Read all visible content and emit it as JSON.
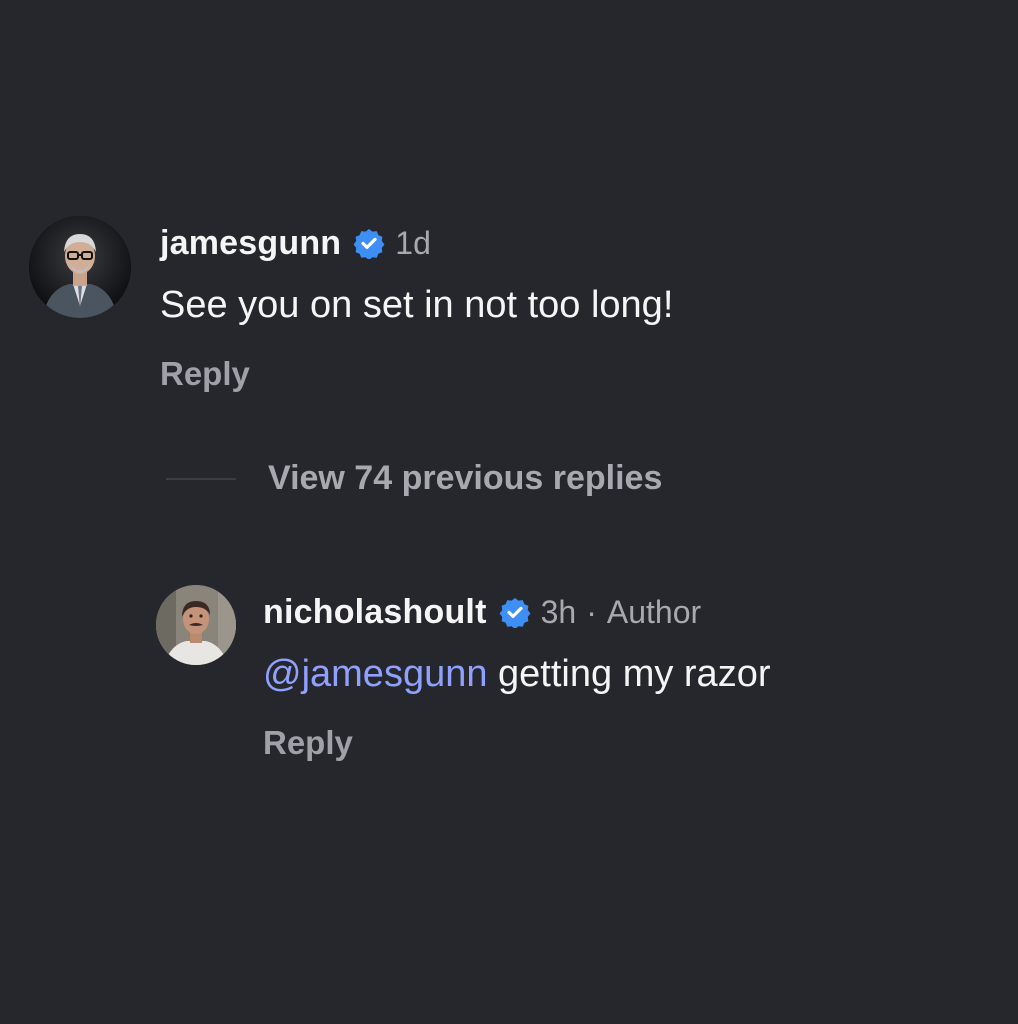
{
  "colors": {
    "background": "#26272c",
    "primary_text": "#f5f5f5",
    "secondary_text": "#a7a9b0",
    "mention": "#8fa0ff",
    "verified_badge": "#3d8ef5"
  },
  "parent_comment": {
    "avatar_icon": "profile-photo-icon",
    "username": "jamesgunn",
    "verified_icon": "verified-badge-icon",
    "time": "1d",
    "text": "See you on set in not too long!",
    "reply_label": "Reply"
  },
  "view_replies": {
    "label": "View 74 previous replies"
  },
  "reply_comment": {
    "avatar_icon": "profile-photo-icon",
    "username": "nicholashoult",
    "verified_icon": "verified-badge-icon",
    "time": "3h",
    "separator": "·",
    "author_tag": "Author",
    "mention": "@jamesgunn",
    "text": " getting my razor",
    "reply_label": "Reply"
  }
}
